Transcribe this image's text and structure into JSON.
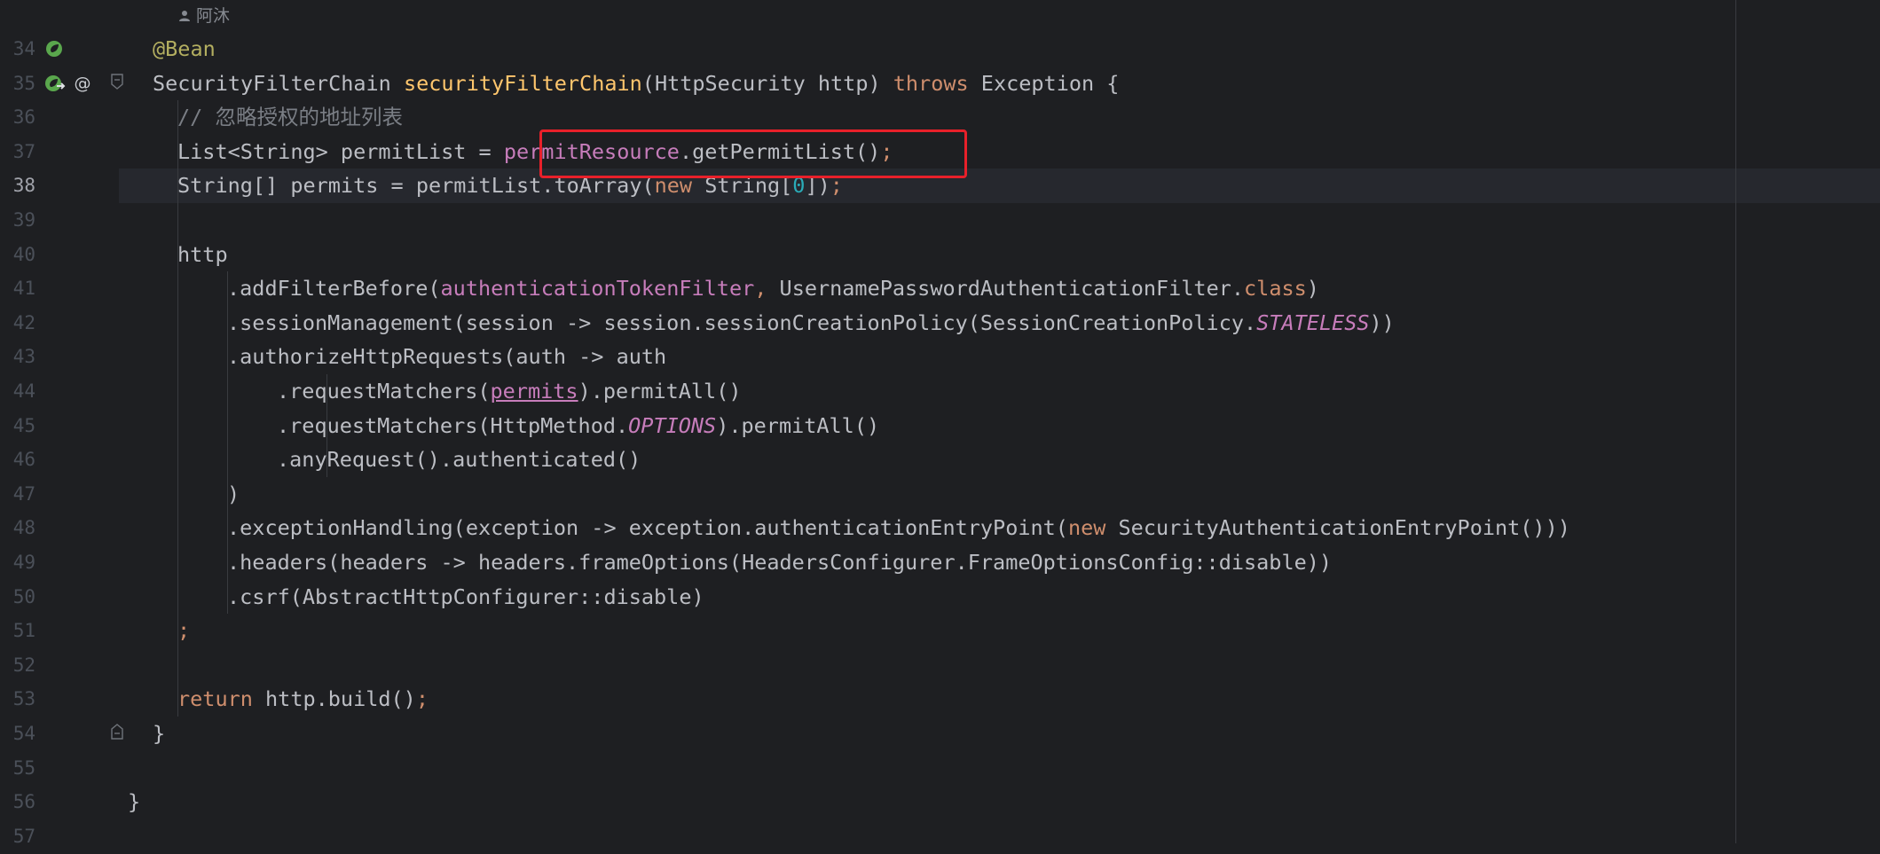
{
  "author_hint": "阿沐",
  "current_line": 38,
  "lines": [
    {
      "num": 34,
      "indent": 1,
      "segments": [
        {
          "t": "@Bean",
          "c": "ann"
        }
      ]
    },
    {
      "num": 35,
      "indent": 1,
      "segments": [
        {
          "t": "SecurityFilterChain "
        },
        {
          "t": "securityFilterChain",
          "c": "decl"
        },
        {
          "t": "(HttpSecurity http) "
        },
        {
          "t": "throws",
          "c": "kw"
        },
        {
          "t": " Exception {"
        }
      ]
    },
    {
      "num": 36,
      "indent": 2,
      "segments": [
        {
          "t": "// 忽略授权的地址列表",
          "c": "cm"
        }
      ]
    },
    {
      "num": 37,
      "indent": 2,
      "segments": [
        {
          "t": "List<String> permitList = "
        },
        {
          "t": "permitResource",
          "c": "field"
        },
        {
          "t": ".getPermitList()"
        },
        {
          "t": ";",
          "c": "kw"
        }
      ]
    },
    {
      "num": 38,
      "indent": 2,
      "segments": [
        {
          "t": "String[] permits = permitList.toArray("
        },
        {
          "t": "new",
          "c": "kw"
        },
        {
          "t": " String["
        },
        {
          "t": "0",
          "c": "num"
        },
        {
          "t": "])"
        },
        {
          "t": ";",
          "c": "kw"
        }
      ]
    },
    {
      "num": 39,
      "indent": 0,
      "segments": []
    },
    {
      "num": 40,
      "indent": 2,
      "segments": [
        {
          "t": "http"
        }
      ]
    },
    {
      "num": 41,
      "indent": 4,
      "segments": [
        {
          "t": ".addFilterBefore("
        },
        {
          "t": "authenticationTokenFilter",
          "c": "field"
        },
        {
          "t": ", ",
          "c": "kw"
        },
        {
          "t": "UsernamePasswordAuthenticationFilter."
        },
        {
          "t": "class",
          "c": "kw"
        },
        {
          "t": ")"
        }
      ]
    },
    {
      "num": 42,
      "indent": 4,
      "segments": [
        {
          "t": ".sessionManagement(session -> session.sessionCreationPolicy(SessionCreationPolicy."
        },
        {
          "t": "STATELESS",
          "c": "sf"
        },
        {
          "t": "))"
        }
      ]
    },
    {
      "num": 43,
      "indent": 4,
      "segments": [
        {
          "t": ".authorizeHttpRequests(auth -> auth"
        }
      ]
    },
    {
      "num": 44,
      "indent": 6,
      "segments": [
        {
          "t": ".requestMatchers("
        },
        {
          "t": "permits",
          "c": "field ul"
        },
        {
          "t": ").permitAll()"
        }
      ]
    },
    {
      "num": 45,
      "indent": 6,
      "segments": [
        {
          "t": ".requestMatchers(HttpMethod."
        },
        {
          "t": "OPTIONS",
          "c": "sf"
        },
        {
          "t": ").permitAll()"
        }
      ]
    },
    {
      "num": 46,
      "indent": 6,
      "segments": [
        {
          "t": ".anyRequest().authenticated()"
        }
      ]
    },
    {
      "num": 47,
      "indent": 4,
      "segments": [
        {
          "t": ")"
        }
      ]
    },
    {
      "num": 48,
      "indent": 4,
      "segments": [
        {
          "t": ".exceptionHandling(exception -> exception.authenticationEntryPoint("
        },
        {
          "t": "new",
          "c": "kw"
        },
        {
          "t": " SecurityAuthenticationEntryPoint()))"
        }
      ]
    },
    {
      "num": 49,
      "indent": 4,
      "segments": [
        {
          "t": ".headers(headers -> headers.frameOptions(HeadersConfigurer.FrameOptionsConfig::disable))"
        }
      ]
    },
    {
      "num": 50,
      "indent": 4,
      "segments": [
        {
          "t": ".csrf(AbstractHttpConfigurer::disable)"
        }
      ]
    },
    {
      "num": 51,
      "indent": 2,
      "segments": [
        {
          "t": ";",
          "c": "kw"
        }
      ]
    },
    {
      "num": 52,
      "indent": 0,
      "segments": []
    },
    {
      "num": 53,
      "indent": 2,
      "segments": [
        {
          "t": "return",
          "c": "kw"
        },
        {
          "t": " http.build()"
        },
        {
          "t": ";",
          "c": "kw"
        }
      ]
    },
    {
      "num": 54,
      "indent": 1,
      "segments": [
        {
          "t": "}"
        }
      ]
    },
    {
      "num": 55,
      "indent": 0,
      "segments": []
    },
    {
      "num": 56,
      "indent": 0,
      "segments": [
        {
          "t": "}"
        }
      ]
    },
    {
      "num": 57,
      "indent": 0,
      "segments": []
    }
  ],
  "gutter_icons": [
    {
      "line": 34,
      "icons": [
        "spring-bean-icon"
      ]
    },
    {
      "line": 35,
      "icons": [
        "spring-bean-navigate-icon",
        "implementations-at-icon",
        "fold-start-icon"
      ]
    },
    {
      "line": 54,
      "icons": [
        "fold-end-icon"
      ]
    }
  ],
  "highlight": {
    "line": 37,
    "text": "permitResource.getPermitList();",
    "color": "#e8202a"
  }
}
